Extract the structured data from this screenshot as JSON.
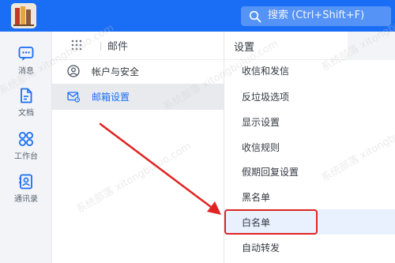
{
  "topbar": {
    "search_placeholder": "搜索 (Ctrl+Shift+F)"
  },
  "sidebar": {
    "items": [
      {
        "label": "消息"
      },
      {
        "label": "文档"
      },
      {
        "label": "工作台"
      },
      {
        "label": "通讯录"
      }
    ]
  },
  "mail_panel": {
    "title": "邮件",
    "items": [
      {
        "label": "帐户与安全"
      },
      {
        "label": "邮箱设置"
      }
    ]
  },
  "settings_panel": {
    "title": "设置",
    "items": [
      {
        "label": "收信和发信"
      },
      {
        "label": "反垃圾选项"
      },
      {
        "label": "显示设置"
      },
      {
        "label": "收信规则"
      },
      {
        "label": "假期回复设置"
      },
      {
        "label": "黑名单"
      },
      {
        "label": "白名单"
      },
      {
        "label": "自动转发"
      }
    ]
  },
  "watermark": {
    "text": "系统部落 xitongbuluo.com"
  },
  "colors": {
    "accent": "#1a6ef5",
    "annotation_red": "#e02424",
    "selected_bg": "#e9f0fe"
  }
}
